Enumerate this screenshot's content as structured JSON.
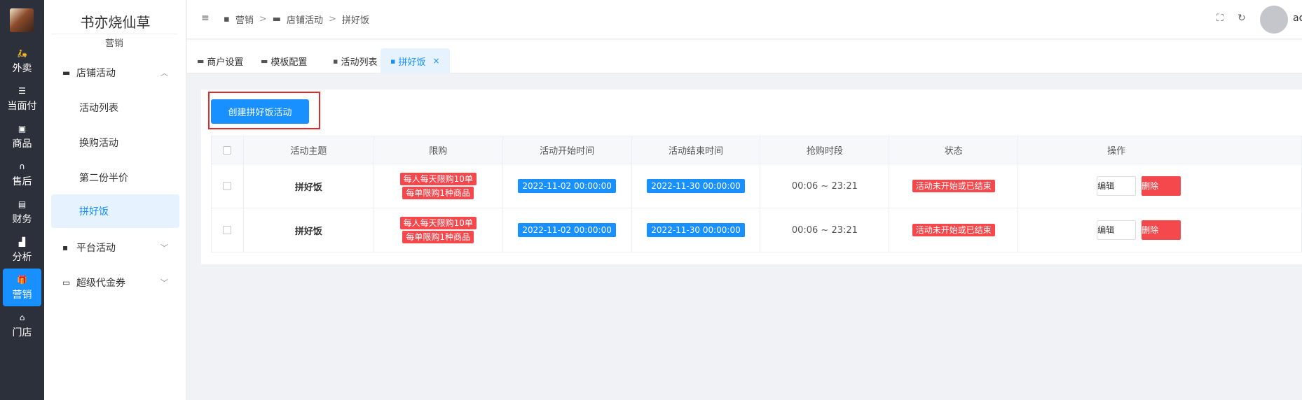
{
  "rail": {
    "items": [
      {
        "label": "外卖",
        "icon": "scooter-icon"
      },
      {
        "label": "当面付",
        "icon": "list-icon"
      },
      {
        "label": "商品",
        "icon": "basket-icon"
      },
      {
        "label": "售后",
        "icon": "headset-icon"
      },
      {
        "label": "财务",
        "icon": "ledger-icon"
      },
      {
        "label": "分析",
        "icon": "bar-chart-icon"
      },
      {
        "label": "营销",
        "icon": "gift-icon",
        "active": true
      },
      {
        "label": "门店",
        "icon": "store-icon"
      }
    ]
  },
  "menu": {
    "shop_name": "书亦烧仙草",
    "section": "营销",
    "groups": [
      {
        "label": "店铺活动",
        "expanded": true,
        "items": [
          "活动列表",
          "换购活动",
          "第二份半价",
          "拼好饭"
        ]
      },
      {
        "label": "平台活动",
        "expanded": false
      },
      {
        "label": "超级代金券",
        "expanded": false
      }
    ],
    "active_item": "拼好饭"
  },
  "header": {
    "breadcrumb": [
      "营销",
      "店铺活动",
      "拼好饭"
    ],
    "user": "ad"
  },
  "tabs": [
    {
      "label": "商户设置",
      "active": false
    },
    {
      "label": "模板配置",
      "active": false
    },
    {
      "label": "活动列表",
      "active": false
    },
    {
      "label": "拼好饭",
      "active": true,
      "closable": true
    }
  ],
  "toolbar": {
    "create_label": "创建拼好饭活动"
  },
  "table": {
    "columns": [
      "活动主题",
      "限购",
      "活动开始时间",
      "活动结束时间",
      "抢购时段",
      "状态",
      "操作"
    ],
    "rows": [
      {
        "subject": "拼好饭",
        "limit1": "每人每天限购10单",
        "limit2": "每单限购1种商品",
        "start": "2022-11-02 00:00:00",
        "end": "2022-11-30 00:00:00",
        "period": "00:06 ~ 23:21",
        "status": "活动未开始或已结束",
        "edit": "编辑",
        "delete": "删除"
      },
      {
        "subject": "拼好饭",
        "limit1": "每人每天限购10单",
        "limit2": "每单限购1种商品",
        "start": "2022-11-02 00:00:00",
        "end": "2022-11-30 00:00:00",
        "period": "00:06 ~ 23:21",
        "status": "活动未开始或已结束",
        "edit": "编辑",
        "delete": "删除"
      }
    ]
  },
  "colors": {
    "accent": "#1890ff",
    "danger": "#f5484d",
    "rail": "#2b303b",
    "highlight": "#e12b2b"
  }
}
